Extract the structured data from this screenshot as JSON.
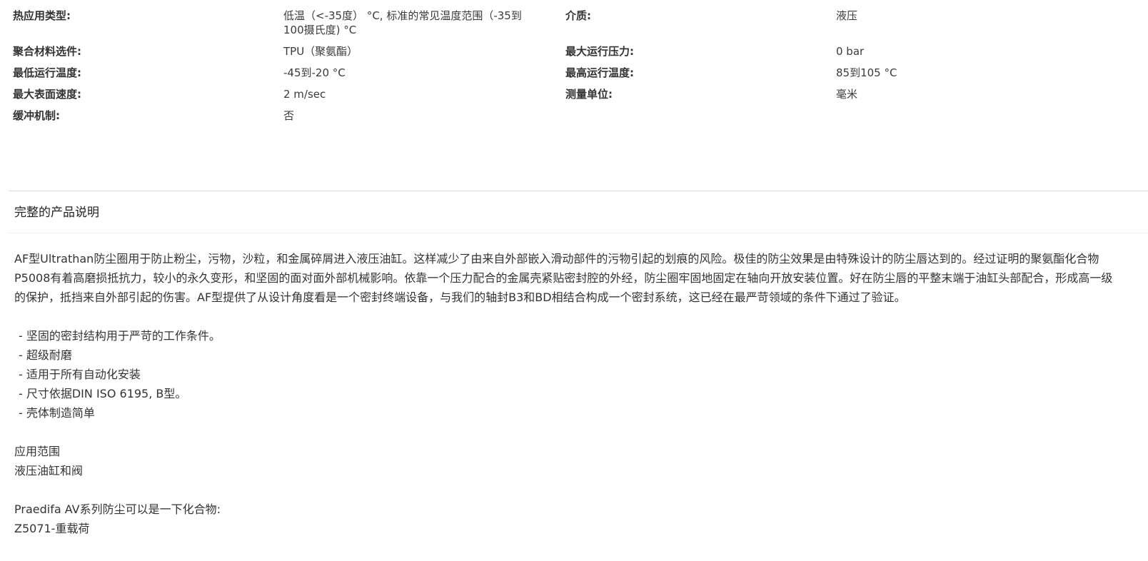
{
  "specs": {
    "rows": [
      {
        "left_label": "热应用类型:",
        "left_value": "低温（<-35度） °C, 标准的常见温度范围（-35到100摄氏度) °C",
        "right_label": "介质:",
        "right_value": "液压"
      },
      {
        "left_label": "聚合材料选件:",
        "left_value": "TPU（聚氨酯）",
        "right_label": "最大运行压力:",
        "right_value": "0 bar"
      },
      {
        "left_label": "最低运行温度:",
        "left_value": "-45到-20 °C",
        "right_label": "最高运行温度:",
        "right_value": "85到105 °C"
      },
      {
        "left_label": "最大表面速度:",
        "left_value": "2 m/sec",
        "right_label": "测量单位:",
        "right_value": "毫米"
      },
      {
        "left_label": "缓冲机制:",
        "left_value": "否"
      }
    ]
  },
  "description": {
    "title": "完整的产品说明",
    "intro": "AF型Ultrathan防尘圈用于防止粉尘，污物，沙粒，和金属碎屑进入液压油缸。这样减少了由来自外部嵌入滑动部件的污物引起的划痕的风险。极佳的防尘效果是由特殊设计的防尘唇达到的。经过证明的聚氨酯化合物P5008有着高磨损抵抗力，较小的永久变形，和坚固的面对面外部机械影响。依靠一个压力配合的金属壳紧贴密封腔的外经，防尘圈牢固地固定在轴向开放安装位置。好在防尘唇的平整末端于油缸头部配合，形成高一级的保护，抵挡来自外部引起的伤害。AF型提供了从设计角度看是一个密封终端设备，与我们的轴封B3和BD相结合构成一个密封系统，这已经在最严苛领域的条件下通过了验证。",
    "bullets": [
      "- 坚固的密封结构用于严苛的工作条件。",
      "- 超级耐磨",
      "- 适用于所有自动化安装",
      "- 尺寸依据DIN ISO 6195, B型。",
      "- 壳体制造简单"
    ],
    "application_heading": "应用范围",
    "application_text": "液压油缸和阀",
    "compounds_heading": "Praedifa AV系列防尘可以是一下化合物:",
    "compounds_text": "Z5071-重载荷"
  }
}
